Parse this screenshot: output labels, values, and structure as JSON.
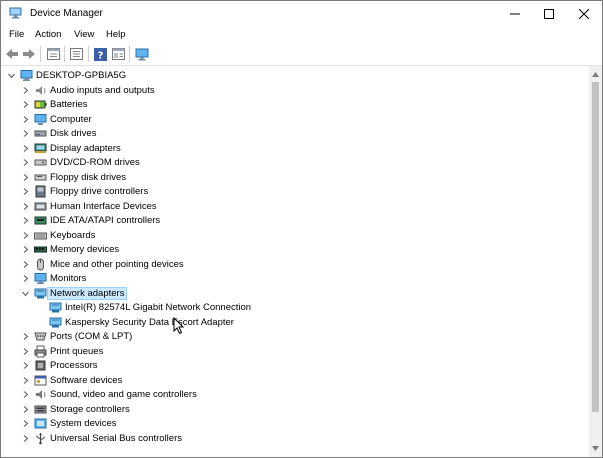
{
  "window": {
    "title": "Device Manager"
  },
  "menu": [
    "File",
    "Action",
    "View",
    "Help"
  ],
  "toolbar": [
    "back-icon",
    "forward-icon",
    "properties-icon",
    "show-hide-icon",
    "help-icon",
    "view-icon",
    "monitor-icon"
  ],
  "tree": {
    "root": "DESKTOP-GPBIA5G",
    "categories": [
      {
        "label": "Audio inputs and outputs",
        "icon": "speaker-icon",
        "expanded": false
      },
      {
        "label": "Batteries",
        "icon": "battery-icon",
        "expanded": false
      },
      {
        "label": "Computer",
        "icon": "computer-icon",
        "expanded": false
      },
      {
        "label": "Disk drives",
        "icon": "disk-drive-icon",
        "expanded": false
      },
      {
        "label": "Display adapters",
        "icon": "display-adapter-icon",
        "expanded": false
      },
      {
        "label": "DVD/CD-ROM drives",
        "icon": "dvd-icon",
        "expanded": false
      },
      {
        "label": "Floppy disk drives",
        "icon": "floppy-icon",
        "expanded": false
      },
      {
        "label": "Floppy drive controllers",
        "icon": "floppy-controller-icon",
        "expanded": false
      },
      {
        "label": "Human Interface Devices",
        "icon": "hid-icon",
        "expanded": false
      },
      {
        "label": "IDE ATA/ATAPI controllers",
        "icon": "ide-icon",
        "expanded": false
      },
      {
        "label": "Keyboards",
        "icon": "keyboard-icon",
        "expanded": false
      },
      {
        "label": "Memory devices",
        "icon": "memory-icon",
        "expanded": false
      },
      {
        "label": "Mice and other pointing devices",
        "icon": "mouse-icon",
        "expanded": false
      },
      {
        "label": "Monitors",
        "icon": "monitor-icon",
        "expanded": false
      },
      {
        "label": "Network adapters",
        "icon": "network-adapter-icon",
        "expanded": true,
        "selected": true,
        "children": [
          {
            "label": "Intel(R) 82574L Gigabit Network Connection",
            "icon": "network-adapter-icon"
          },
          {
            "label": "Kaspersky Security Data Escort Adapter",
            "icon": "network-adapter-icon"
          }
        ]
      },
      {
        "label": "Ports (COM & LPT)",
        "icon": "port-icon",
        "expanded": false
      },
      {
        "label": "Print queues",
        "icon": "printer-icon",
        "expanded": false
      },
      {
        "label": "Processors",
        "icon": "processor-icon",
        "expanded": false
      },
      {
        "label": "Software devices",
        "icon": "software-device-icon",
        "expanded": false
      },
      {
        "label": "Sound, video and game controllers",
        "icon": "sound-icon",
        "expanded": false
      },
      {
        "label": "Storage controllers",
        "icon": "storage-icon",
        "expanded": false
      },
      {
        "label": "System devices",
        "icon": "system-icon",
        "expanded": false
      },
      {
        "label": "Universal Serial Bus controllers",
        "icon": "usb-icon",
        "expanded": false
      }
    ]
  },
  "colors": {
    "selection_bg": "#cce8ff",
    "selection_border": "#99d1ff",
    "adapter_blue": "#2a8ad4"
  }
}
